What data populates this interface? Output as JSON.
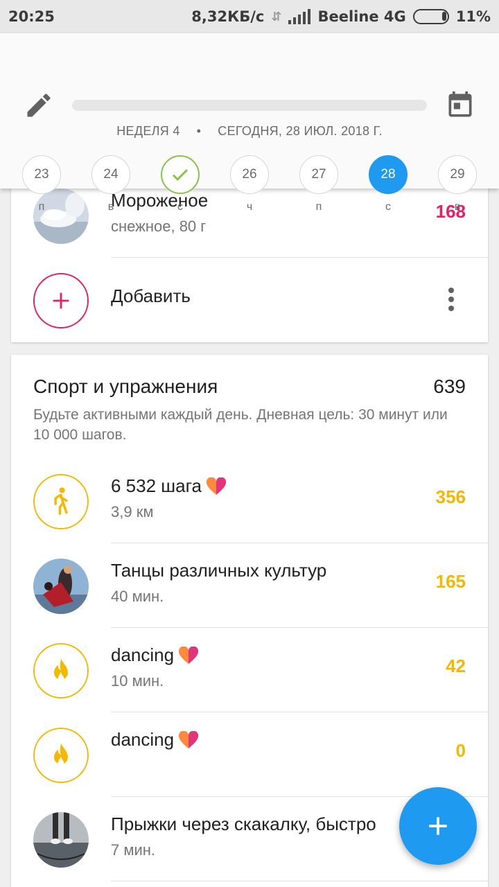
{
  "status_bar": {
    "time": "20:25",
    "speed": "8,32КБ/с",
    "carrier": "Beeline 4G",
    "battery": "11%"
  },
  "header": {
    "week_label": "НЕДЕЛЯ 4",
    "separator": "•",
    "today_label": "СЕГОДНЯ, 28 ИЮЛ. 2018 Г.",
    "days": [
      {
        "num": "23",
        "letter": "п",
        "state": "normal"
      },
      {
        "num": "24",
        "letter": "в",
        "state": "normal"
      },
      {
        "num": "",
        "letter": "с",
        "state": "done"
      },
      {
        "num": "26",
        "letter": "ч",
        "state": "normal"
      },
      {
        "num": "27",
        "letter": "п",
        "state": "normal"
      },
      {
        "num": "28",
        "letter": "с",
        "state": "today"
      },
      {
        "num": "29",
        "letter": "в",
        "state": "normal"
      }
    ]
  },
  "food_card": {
    "item": {
      "title": "Мороженое",
      "sub": "снежное, 80 г",
      "kcal": "168"
    },
    "add_label": "Добавить"
  },
  "sport_card": {
    "title": "Спорт и упражнения",
    "kcal": "639",
    "description": "Будьте активными каждый день. Дневная цель: 30 минут или 10 000 шагов.",
    "items": [
      {
        "title": "6 532 шага",
        "sub": "3,9 км",
        "kcal": "356"
      },
      {
        "title": "Танцы различных культур",
        "sub": "40 мин.",
        "kcal": "165"
      },
      {
        "title": "dancing",
        "sub": "10 мин.",
        "kcal": "42"
      },
      {
        "title": "dancing",
        "sub": "",
        "kcal": "0"
      },
      {
        "title": "Прыжки через скакалку, быстро",
        "sub": "7 мин.",
        "kcal": ""
      }
    ]
  },
  "colors": {
    "accent": "#1e9bf0",
    "food_kcal": "#e91e63",
    "sport_kcal": "#f5b800",
    "done_green": "#8bc34a"
  }
}
